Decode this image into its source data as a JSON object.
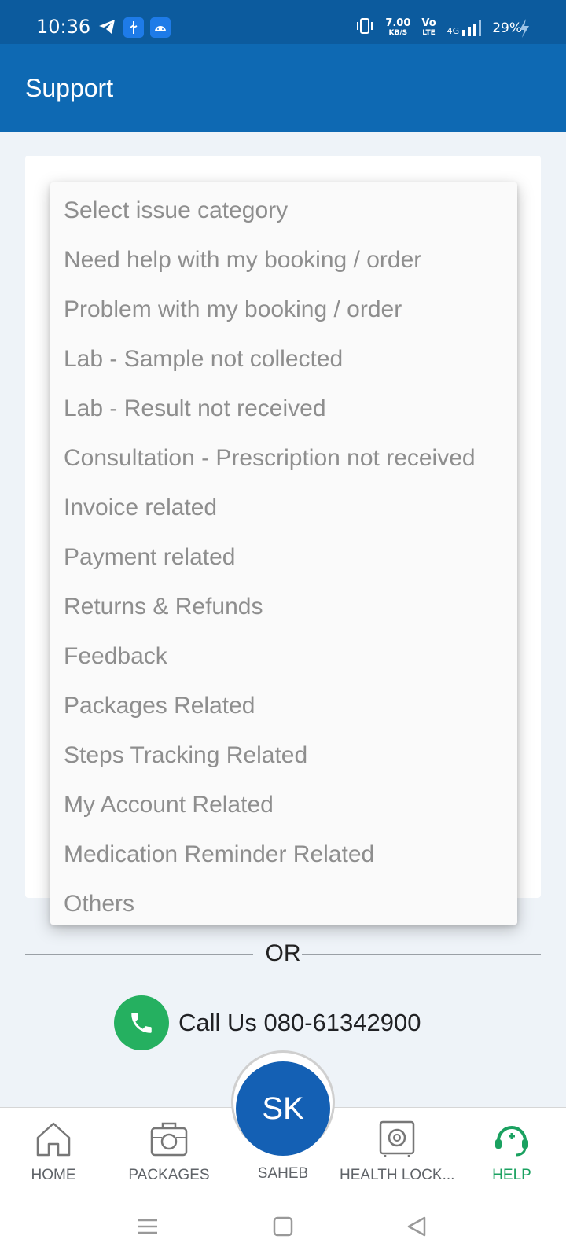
{
  "status_bar": {
    "time": "10:36",
    "speed_value": "7.00",
    "speed_unit": "KB/S",
    "volte_top": "Vo",
    "volte_bottom": "LTE",
    "network": "4G",
    "battery": "29%",
    "icons": [
      "telegram-icon",
      "usb-icon",
      "android-icon",
      "vibrate-icon",
      "signal-icon",
      "charging-icon"
    ]
  },
  "header": {
    "title": "Support"
  },
  "dropdown": {
    "items": [
      "Select issue category",
      "Need help with my booking / order",
      "Problem with my booking / order",
      "Lab - Sample not collected",
      "Lab - Result not received",
      "Consultation - Prescription not received",
      "Invoice related",
      "Payment related",
      "Returns & Refunds",
      "Feedback",
      "Packages Related",
      "Steps Tracking Related",
      "My Account Related",
      "Medication Reminder Related",
      "Others"
    ]
  },
  "separator": {
    "text": "OR"
  },
  "call": {
    "label": "Call Us 080-61342900"
  },
  "bottom_nav": {
    "home": "HOME",
    "packages": "PACKAGES",
    "profile_initials": "SK",
    "profile_name": "SAHEB",
    "health_locker": "HEALTH LOCK...",
    "help": "HELP",
    "active": "help"
  },
  "colors": {
    "primary": "#0e69b3",
    "status_bar": "#0c5b9e",
    "call_green": "#25b060",
    "active_green": "#1aa160",
    "avatar_blue": "#1460b4"
  }
}
